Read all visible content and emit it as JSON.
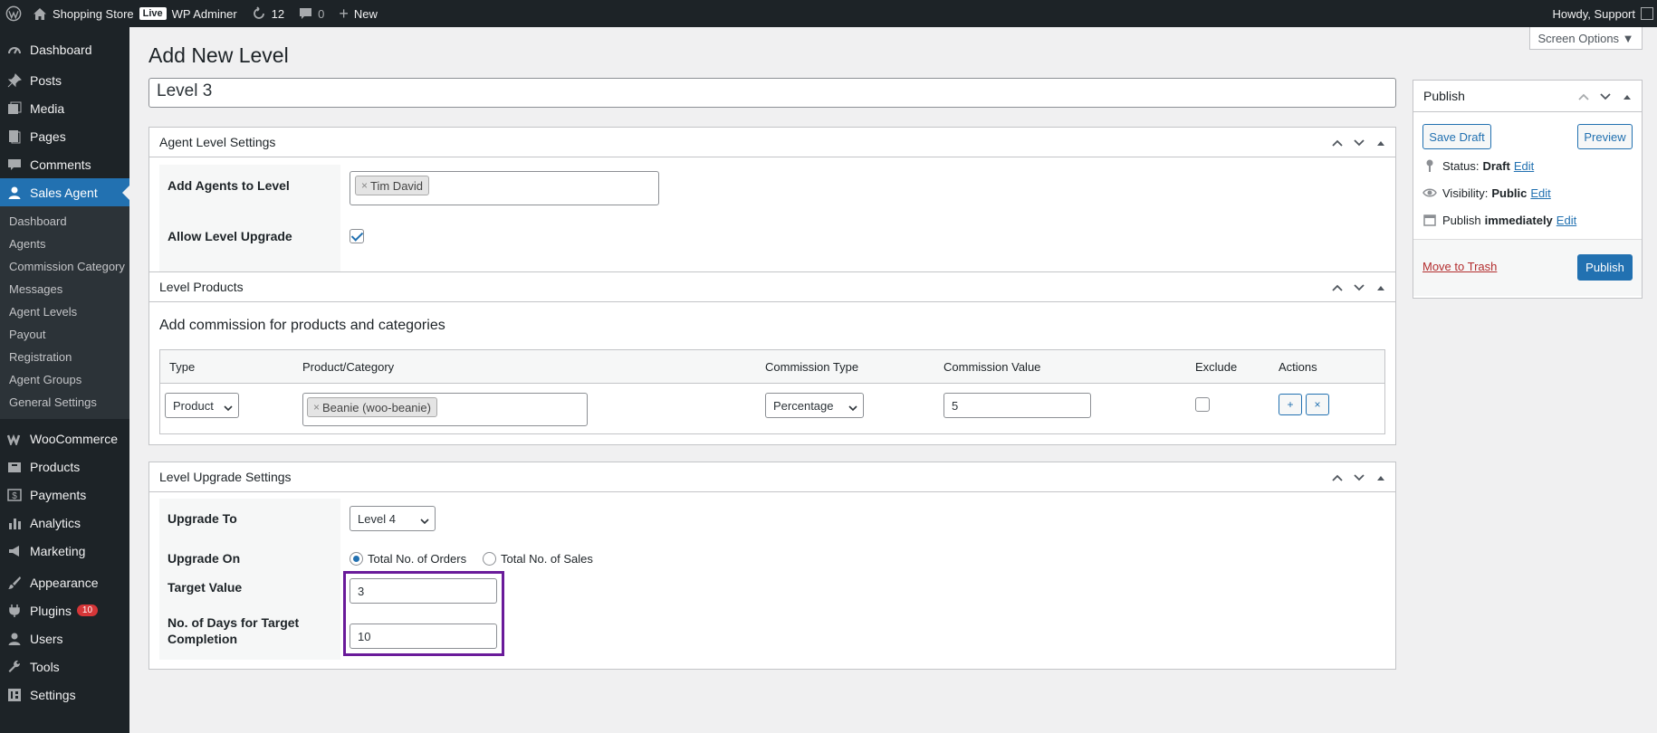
{
  "adminbar": {
    "site_name": "Shopping Store",
    "live_badge": "Live",
    "wp_admin_label": "WP Adminer",
    "updates_count": "12",
    "comments_count": "0",
    "new_label": "New",
    "howdy": "Howdy, Support"
  },
  "sidebar": {
    "items": [
      {
        "label": "Dashboard",
        "icon": "dashboard-icon"
      },
      {
        "label": "Posts",
        "icon": "pin-icon"
      },
      {
        "label": "Media",
        "icon": "media-icon"
      },
      {
        "label": "Pages",
        "icon": "pages-icon"
      },
      {
        "label": "Comments",
        "icon": "comment-icon"
      },
      {
        "label": "Sales Agent",
        "icon": "user-icon"
      }
    ],
    "submenu": [
      "Dashboard",
      "Agents",
      "Commission Category",
      "Messages",
      "Agent Levels",
      "Payout",
      "Registration",
      "Agent Groups",
      "General Settings"
    ],
    "items2": [
      {
        "label": "WooCommerce",
        "icon": "woo-icon"
      },
      {
        "label": "Products",
        "icon": "box-icon"
      },
      {
        "label": "Payments",
        "icon": "dollar-icon"
      },
      {
        "label": "Analytics",
        "icon": "chart-icon"
      },
      {
        "label": "Marketing",
        "icon": "megaphone-icon"
      },
      {
        "label": "Appearance",
        "icon": "brush-icon"
      },
      {
        "label": "Plugins",
        "icon": "plug-icon",
        "badge": "10"
      },
      {
        "label": "Users",
        "icon": "users-icon"
      },
      {
        "label": "Tools",
        "icon": "wrench-icon"
      },
      {
        "label": "Settings",
        "icon": "settings-icon"
      }
    ]
  },
  "page": {
    "title": "Add New Level",
    "screen_options": "Screen Options ▼",
    "level_title": "Level 3"
  },
  "agent_settings": {
    "title": "Agent Level Settings",
    "add_agents_label": "Add Agents to Level",
    "agent_chip": "Tim David",
    "allow_upgrade_label": "Allow Level Upgrade",
    "allow_upgrade_checked": true
  },
  "level_products": {
    "title": "Level Products",
    "subtitle": "Add commission for products and categories",
    "columns": [
      "Type",
      "Product/Category",
      "Commission Type",
      "Commission Value",
      "Exclude",
      "Actions"
    ],
    "row": {
      "type": "Product",
      "product_chip": "Beanie (woo-beanie)",
      "commission_type": "Percentage",
      "commission_value": "5",
      "add_btn": "+",
      "remove_btn": "×"
    }
  },
  "upgrade_settings": {
    "title": "Level Upgrade Settings",
    "upgrade_to_label": "Upgrade To",
    "upgrade_to_value": "Level 4",
    "upgrade_on_label": "Upgrade On",
    "radio1": "Total No. of Orders",
    "radio2": "Total No. of Sales",
    "target_label": "Target Value",
    "target_value": "3",
    "days_label_1": "No. of Days for Target",
    "days_label_2": "Completion",
    "days_value": "10"
  },
  "publish": {
    "title": "Publish",
    "save_draft": "Save Draft",
    "preview": "Preview",
    "status_label": "Status:",
    "status_value": "Draft",
    "visibility_label": "Visibility:",
    "visibility_value": "Public",
    "publish_label": "Publish",
    "publish_value": "immediately",
    "edit": "Edit",
    "move_to_trash": "Move to Trash",
    "publish_btn": "Publish"
  }
}
